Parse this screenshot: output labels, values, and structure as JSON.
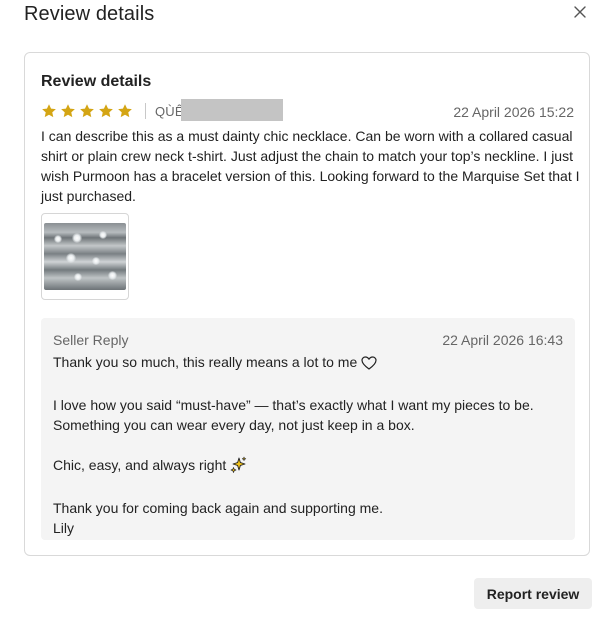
{
  "modal": {
    "title": "Review details",
    "close_icon": "close-icon"
  },
  "review": {
    "heading": "Review details",
    "rating": 5,
    "rating_max": 5,
    "star_color": "#d4a514",
    "reviewer_prefix": "QÙÊ",
    "date": "22 April 2026 15:22",
    "text": "I can describe this as a must dainty chic necklace. Can be worn with a collared casual shirt or plain crew neck t-shirt. Just adjust the chain to match your top’s neckline. I just wish Purmoon has a bracelet version of this. Looking forward to the Marquise Set that I just purchased."
  },
  "seller_reply": {
    "label": "Seller Reply",
    "date": "22 April 2026 16:43",
    "lines": [
      "Thank you so much, this really means a lot to me",
      "",
      "I love how you said “must-have” — that’s exactly what I want my pieces to be. Something you can wear every day, not just keep in a box.",
      "",
      "Chic, easy, and always right",
      "",
      "Thank you for coming back again and supporting me.",
      "Lily"
    ],
    "icons": {
      "heart": "heart-outline-icon",
      "sparkle": "sparkles-icon"
    }
  },
  "actions": {
    "report_label": "Report review"
  }
}
